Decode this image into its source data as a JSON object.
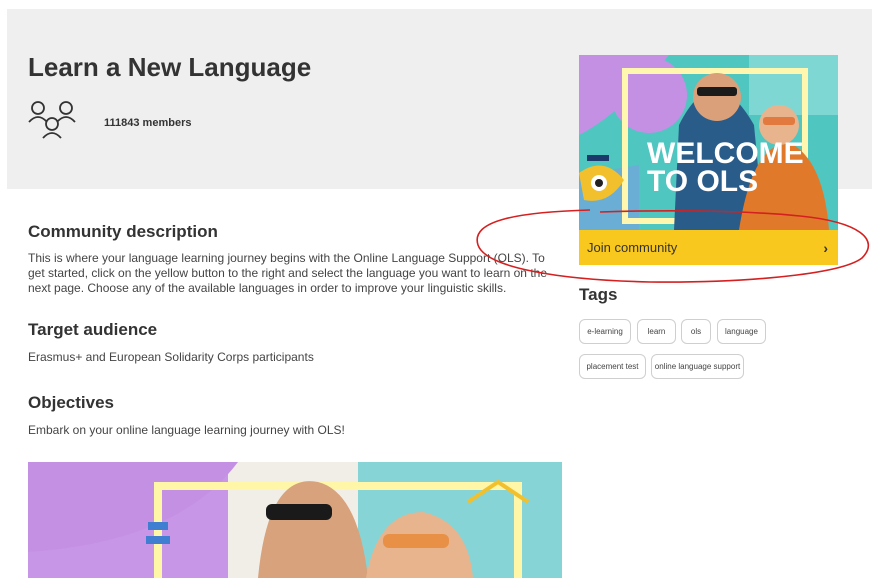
{
  "community": {
    "title": "Learn a New Language",
    "members": "111843 members"
  },
  "welcome_card": {
    "image_text_line1": "WELCOME",
    "image_text_line2": "TO OLS",
    "join_label": "Join community"
  },
  "sections": {
    "description_heading": "Community description",
    "description_text": "This is where your language learning journey begins with the Online Language Support (OLS). To get started, click on the yellow button to the right and select the language you want to learn on the next page. Choose any of the available languages in order to improve your linguistic skills.",
    "audience_heading": "Target audience",
    "audience_text": "Erasmus+ and European Solidarity Corps participants",
    "objectives_heading": "Objectives",
    "objectives_text": "Embark on your online language learning journey with OLS!"
  },
  "tags": {
    "heading": "Tags",
    "items": [
      "e-learning",
      "learn",
      "ols",
      "language",
      "placement test",
      "online language support"
    ]
  },
  "colors": {
    "hero_bg": "#efefef",
    "accent_yellow": "#f8c81e",
    "annotation_red": "#d42020"
  }
}
